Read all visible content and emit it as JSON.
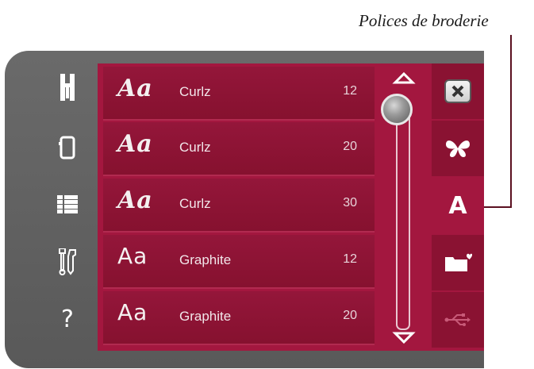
{
  "callout": {
    "label": "Polices de broderie"
  },
  "font_list": [
    {
      "preview": "Aa",
      "name": "Curlz",
      "size": "12"
    },
    {
      "preview": "Aa",
      "name": "Curlz",
      "size": "20"
    },
    {
      "preview": "Aa",
      "name": "Curlz",
      "size": "30"
    },
    {
      "preview": "Aa",
      "name": "Graphite",
      "size": "12"
    },
    {
      "preview": "Aa",
      "name": "Graphite",
      "size": "20"
    }
  ],
  "left_rail": {
    "help_label": "?"
  },
  "right_col": {
    "font_tab_label": "A"
  },
  "colors": {
    "panel": "#a3173f",
    "row": "#8c1334",
    "device": "#626262"
  }
}
